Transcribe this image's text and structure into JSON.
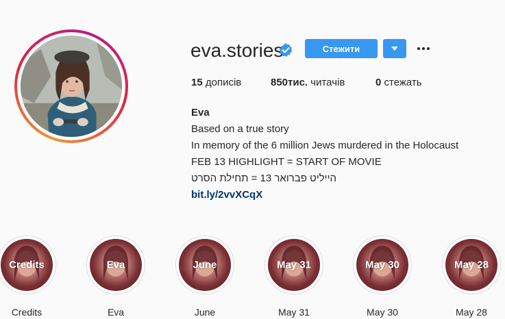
{
  "profile": {
    "username": "eva.stories",
    "verified": true,
    "follow_label": "Стежити",
    "stats": {
      "posts_value": "15",
      "posts_label": "дописів",
      "followers_value": "850тис.",
      "followers_label": "читачів",
      "following_value": "0",
      "following_label": "стежать"
    },
    "bio": {
      "name": "Eva",
      "lines": [
        "Based on a true story",
        "In memory of the 6 million Jews murdered in the Holocaust",
        "FEB 13 HIGHLIGHT = START OF MOVIE",
        "הייליט פברואר 13 = תחילת הסרט"
      ],
      "link": "bit.ly/2vvXCqX"
    }
  },
  "highlights": [
    {
      "title": "Credits",
      "label": "Credits"
    },
    {
      "title": "Eva",
      "label": "Eva"
    },
    {
      "title": "June",
      "label": "June"
    },
    {
      "title": "May 31",
      "label": "May 31"
    },
    {
      "title": "May 30",
      "label": "May 30"
    },
    {
      "title": "May 28",
      "label": "May 28"
    }
  ],
  "colors": {
    "accent": "#3897f0",
    "link": "#003569",
    "text": "#262626",
    "background": "#fafafa"
  },
  "icons": [
    "verified-badge-icon",
    "chevron-down-icon",
    "more-options-icon"
  ]
}
